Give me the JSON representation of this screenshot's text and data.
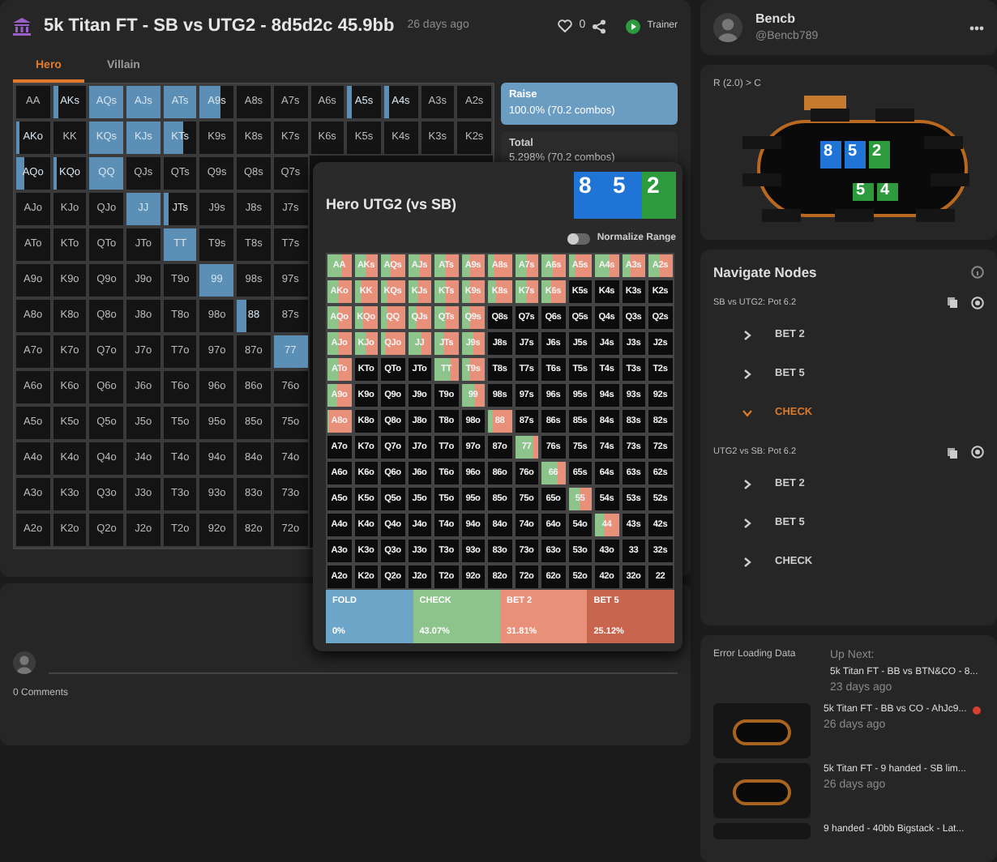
{
  "header": {
    "title": "5k Titan FT - SB vs UTG2 - 8d5d2c 45.9bb",
    "age": "26 days ago",
    "likes": "0",
    "trainer": "Trainer"
  },
  "tabs": [
    {
      "label": "Hero",
      "selected": true
    },
    {
      "label": "Villain",
      "selected": false
    }
  ],
  "range_grid": {
    "rows": [
      [
        {
          "hand": "AA"
        },
        {
          "hand": "AKs",
          "level": 0.15
        },
        {
          "hand": "AQs",
          "level": 1
        },
        {
          "hand": "AJs",
          "level": 1
        },
        {
          "hand": "ATs",
          "level": 1
        },
        {
          "hand": "A9s",
          "level": 0.6
        },
        {
          "hand": "A8s"
        },
        {
          "hand": "A7s"
        },
        {
          "hand": "A6s"
        },
        {
          "hand": "A5s",
          "level": 0.15
        },
        {
          "hand": "A4s",
          "level": 0.15
        },
        {
          "hand": "A3s"
        },
        {
          "hand": "A2s"
        }
      ],
      [
        {
          "hand": "AKo",
          "level": 0.1
        },
        {
          "hand": "KK"
        },
        {
          "hand": "KQs",
          "level": 1
        },
        {
          "hand": "KJs",
          "level": 1
        },
        {
          "hand": "KTs",
          "level": 0.6
        },
        {
          "hand": "K9s"
        },
        {
          "hand": "K8s"
        },
        {
          "hand": "K7s"
        },
        {
          "hand": "K6s"
        },
        {
          "hand": "K5s"
        },
        {
          "hand": "K4s"
        },
        {
          "hand": "K3s"
        },
        {
          "hand": "K2s"
        }
      ],
      [
        {
          "hand": "AQo",
          "level": 0.25
        },
        {
          "hand": "KQo",
          "level": 0.1
        },
        {
          "hand": "QQ",
          "level": 1
        },
        {
          "hand": "QJs"
        },
        {
          "hand": "QTs"
        },
        {
          "hand": "Q9s"
        },
        {
          "hand": "Q8s"
        },
        {
          "hand": "Q7s"
        }
      ],
      [
        {
          "hand": "AJo"
        },
        {
          "hand": "KJo"
        },
        {
          "hand": "QJo"
        },
        {
          "hand": "JJ",
          "level": 1
        },
        {
          "hand": "JTs",
          "level": 0.15
        },
        {
          "hand": "J9s"
        },
        {
          "hand": "J8s"
        },
        {
          "hand": "J7s"
        }
      ],
      [
        {
          "hand": "ATo"
        },
        {
          "hand": "KTo"
        },
        {
          "hand": "QTo"
        },
        {
          "hand": "JTo"
        },
        {
          "hand": "TT",
          "level": 1
        },
        {
          "hand": "T9s"
        },
        {
          "hand": "T8s"
        },
        {
          "hand": "T7s"
        }
      ],
      [
        {
          "hand": "A9o"
        },
        {
          "hand": "K9o"
        },
        {
          "hand": "Q9o"
        },
        {
          "hand": "J9o"
        },
        {
          "hand": "T9o"
        },
        {
          "hand": "99",
          "level": 1
        },
        {
          "hand": "98s"
        },
        {
          "hand": "97s"
        }
      ],
      [
        {
          "hand": "A8o"
        },
        {
          "hand": "K8o"
        },
        {
          "hand": "Q8o"
        },
        {
          "hand": "J8o"
        },
        {
          "hand": "T8o"
        },
        {
          "hand": "98o"
        },
        {
          "hand": "88",
          "level": 0.3
        },
        {
          "hand": "87s"
        }
      ],
      [
        {
          "hand": "A7o"
        },
        {
          "hand": "K7o"
        },
        {
          "hand": "Q7o"
        },
        {
          "hand": "J7o"
        },
        {
          "hand": "T7o"
        },
        {
          "hand": "97o"
        },
        {
          "hand": "87o"
        },
        {
          "hand": "77",
          "level": 1
        }
      ],
      [
        {
          "hand": "A6o"
        },
        {
          "hand": "K6o"
        },
        {
          "hand": "Q6o"
        },
        {
          "hand": "J6o"
        },
        {
          "hand": "T6o"
        },
        {
          "hand": "96o"
        },
        {
          "hand": "86o"
        },
        {
          "hand": "76o"
        }
      ],
      [
        {
          "hand": "A5o"
        },
        {
          "hand": "K5o"
        },
        {
          "hand": "Q5o"
        },
        {
          "hand": "J5o"
        },
        {
          "hand": "T5o"
        },
        {
          "hand": "95o"
        },
        {
          "hand": "85o"
        },
        {
          "hand": "75o"
        }
      ],
      [
        {
          "hand": "A4o"
        },
        {
          "hand": "K4o"
        },
        {
          "hand": "Q4o"
        },
        {
          "hand": "J4o"
        },
        {
          "hand": "T4o"
        },
        {
          "hand": "94o"
        },
        {
          "hand": "84o"
        },
        {
          "hand": "74o"
        }
      ],
      [
        {
          "hand": "A3o"
        },
        {
          "hand": "K3o"
        },
        {
          "hand": "Q3o"
        },
        {
          "hand": "J3o"
        },
        {
          "hand": "T3o"
        },
        {
          "hand": "93o"
        },
        {
          "hand": "83o"
        },
        {
          "hand": "73o"
        }
      ],
      [
        {
          "hand": "A2o"
        },
        {
          "hand": "K2o"
        },
        {
          "hand": "Q2o"
        },
        {
          "hand": "J2o"
        },
        {
          "hand": "T2o"
        },
        {
          "hand": "92o"
        },
        {
          "hand": "82o"
        },
        {
          "hand": "72o"
        }
      ]
    ]
  },
  "summary": [
    {
      "kind": "action",
      "label": "Raise",
      "value": "100.0% (70.2 combos)"
    },
    {
      "kind": "total",
      "label": "Total",
      "value": "5.298% (70.2 combos)"
    }
  ],
  "popup": {
    "title": "Hero UTG2 (vs SB)",
    "board": [
      {
        "rank": "8",
        "color": "#1f74d6"
      },
      {
        "rank": "5",
        "color": "#1f74d6"
      },
      {
        "rank": "2",
        "color": "#2e9a3e"
      }
    ],
    "normalize": {
      "label": "Normalize Range",
      "on": false
    },
    "rows": [
      [
        {
          "hand": "AA",
          "level": 0.6
        },
        {
          "hand": "AKs",
          "level": 0.5
        },
        {
          "hand": "AQs",
          "level": 0.4
        },
        {
          "hand": "AJs",
          "level": 0.55
        },
        {
          "hand": "ATs",
          "level": 0.5
        },
        {
          "hand": "A9s",
          "level": 0.4
        },
        {
          "hand": "A8s",
          "level": 0.3
        },
        {
          "hand": "A7s",
          "level": 0.5
        },
        {
          "hand": "A6s",
          "level": 0.45
        },
        {
          "hand": "A5s",
          "level": 0.3
        },
        {
          "hand": "A4s",
          "level": 0.6
        },
        {
          "hand": "A3s",
          "level": 0.4
        },
        {
          "hand": "A2s",
          "level": 0.5
        }
      ],
      [
        {
          "hand": "AKo",
          "level": 0.5
        },
        {
          "hand": "KK",
          "level": 0.3
        },
        {
          "hand": "KQs",
          "level": 0.3
        },
        {
          "hand": "KJs",
          "level": 0.45
        },
        {
          "hand": "KTs",
          "level": 0.5
        },
        {
          "hand": "K9s",
          "level": 0.4
        },
        {
          "hand": "K8s",
          "level": 0.35
        },
        {
          "hand": "K7s",
          "level": 0.5
        },
        {
          "hand": "K6s",
          "level": 0.4
        },
        {
          "hand": "K5s"
        },
        {
          "hand": "K4s"
        },
        {
          "hand": "K3s"
        },
        {
          "hand": "K2s"
        }
      ],
      [
        {
          "hand": "AQo",
          "level": 0.5
        },
        {
          "hand": "KQo",
          "level": 0.4
        },
        {
          "hand": "QQ",
          "level": 0.3
        },
        {
          "hand": "QJs",
          "level": 0.4
        },
        {
          "hand": "QTs",
          "level": 0.5
        },
        {
          "hand": "Q9s",
          "level": 0.4
        },
        {
          "hand": "Q8s"
        },
        {
          "hand": "Q7s"
        },
        {
          "hand": "Q6s"
        },
        {
          "hand": "Q5s"
        },
        {
          "hand": "Q4s"
        },
        {
          "hand": "Q3s"
        },
        {
          "hand": "Q2s"
        }
      ],
      [
        {
          "hand": "AJo",
          "level": 0.5
        },
        {
          "hand": "KJo",
          "level": 0.5
        },
        {
          "hand": "QJo",
          "level": 0.2
        },
        {
          "hand": "JJ",
          "level": 0.6
        },
        {
          "hand": "JTs",
          "level": 0.4
        },
        {
          "hand": "J9s",
          "level": 0.5
        },
        {
          "hand": "J8s"
        },
        {
          "hand": "J7s"
        },
        {
          "hand": "J6s"
        },
        {
          "hand": "J5s"
        },
        {
          "hand": "J4s"
        },
        {
          "hand": "J3s"
        },
        {
          "hand": "J2s"
        }
      ],
      [
        {
          "hand": "ATo",
          "level": 0.5
        },
        {
          "hand": "KTo"
        },
        {
          "hand": "QTo"
        },
        {
          "hand": "JTo"
        },
        {
          "hand": "TT",
          "level": 0.7
        },
        {
          "hand": "T9s",
          "level": 0.4
        },
        {
          "hand": "T8s"
        },
        {
          "hand": "T7s"
        },
        {
          "hand": "T6s"
        },
        {
          "hand": "T5s"
        },
        {
          "hand": "T4s"
        },
        {
          "hand": "T3s"
        },
        {
          "hand": "T2s"
        }
      ],
      [
        {
          "hand": "A9o",
          "level": 0.4
        },
        {
          "hand": "K9o"
        },
        {
          "hand": "Q9o"
        },
        {
          "hand": "J9o"
        },
        {
          "hand": "T9o"
        },
        {
          "hand": "99",
          "level": 0.6
        },
        {
          "hand": "98s"
        },
        {
          "hand": "97s"
        },
        {
          "hand": "96s"
        },
        {
          "hand": "95s"
        },
        {
          "hand": "94s"
        },
        {
          "hand": "93s"
        },
        {
          "hand": "92s"
        }
      ],
      [
        {
          "hand": "A8o",
          "level": 0.1
        },
        {
          "hand": "K8o"
        },
        {
          "hand": "Q8o"
        },
        {
          "hand": "J8o"
        },
        {
          "hand": "T8o"
        },
        {
          "hand": "98o"
        },
        {
          "hand": "88",
          "level": 0.2
        },
        {
          "hand": "87s"
        },
        {
          "hand": "86s"
        },
        {
          "hand": "85s"
        },
        {
          "hand": "84s"
        },
        {
          "hand": "83s"
        },
        {
          "hand": "82s"
        }
      ],
      [
        {
          "hand": "A7o"
        },
        {
          "hand": "K7o"
        },
        {
          "hand": "Q7o"
        },
        {
          "hand": "J7o"
        },
        {
          "hand": "T7o"
        },
        {
          "hand": "97o"
        },
        {
          "hand": "87o"
        },
        {
          "hand": "77",
          "level": 0.8
        },
        {
          "hand": "76s"
        },
        {
          "hand": "75s"
        },
        {
          "hand": "74s"
        },
        {
          "hand": "73s"
        },
        {
          "hand": "72s"
        }
      ],
      [
        {
          "hand": "A6o"
        },
        {
          "hand": "K6o"
        },
        {
          "hand": "Q6o"
        },
        {
          "hand": "J6o"
        },
        {
          "hand": "T6o"
        },
        {
          "hand": "96o"
        },
        {
          "hand": "86o"
        },
        {
          "hand": "76o"
        },
        {
          "hand": "66",
          "level": 0.7
        },
        {
          "hand": "65s"
        },
        {
          "hand": "64s"
        },
        {
          "hand": "63s"
        },
        {
          "hand": "62s"
        }
      ],
      [
        {
          "hand": "A5o"
        },
        {
          "hand": "K5o"
        },
        {
          "hand": "Q5o"
        },
        {
          "hand": "J5o"
        },
        {
          "hand": "T5o"
        },
        {
          "hand": "95o"
        },
        {
          "hand": "85o"
        },
        {
          "hand": "75o"
        },
        {
          "hand": "65o"
        },
        {
          "hand": "55",
          "level": 0.5
        },
        {
          "hand": "54s"
        },
        {
          "hand": "53s"
        },
        {
          "hand": "52s"
        }
      ],
      [
        {
          "hand": "A4o"
        },
        {
          "hand": "K4o"
        },
        {
          "hand": "Q4o"
        },
        {
          "hand": "J4o"
        },
        {
          "hand": "T4o"
        },
        {
          "hand": "94o"
        },
        {
          "hand": "84o"
        },
        {
          "hand": "74o"
        },
        {
          "hand": "64o"
        },
        {
          "hand": "54o"
        },
        {
          "hand": "44",
          "level": 0.4
        },
        {
          "hand": "43s"
        },
        {
          "hand": "42s"
        }
      ],
      [
        {
          "hand": "A3o"
        },
        {
          "hand": "K3o"
        },
        {
          "hand": "Q3o"
        },
        {
          "hand": "J3o"
        },
        {
          "hand": "T3o"
        },
        {
          "hand": "93o"
        },
        {
          "hand": "83o"
        },
        {
          "hand": "73o"
        },
        {
          "hand": "63o"
        },
        {
          "hand": "53o"
        },
        {
          "hand": "43o"
        },
        {
          "hand": "33"
        },
        {
          "hand": "32s"
        }
      ],
      [
        {
          "hand": "A2o"
        },
        {
          "hand": "K2o"
        },
        {
          "hand": "Q2o"
        },
        {
          "hand": "J2o"
        },
        {
          "hand": "T2o"
        },
        {
          "hand": "92o"
        },
        {
          "hand": "82o"
        },
        {
          "hand": "72o"
        },
        {
          "hand": "62o"
        },
        {
          "hand": "52o"
        },
        {
          "hand": "42o"
        },
        {
          "hand": "32o"
        },
        {
          "hand": "22"
        }
      ]
    ],
    "legend": [
      {
        "label": "FOLD",
        "value": "0%",
        "color": "#6ea6c9"
      },
      {
        "label": "CHECK",
        "value": "43.07%",
        "color": "#8cc48c"
      },
      {
        "label": "BET 2",
        "value": "31.81%",
        "color": "#e8907a"
      },
      {
        "label": "BET 5",
        "value": "25.12%",
        "color": "#c8654f"
      }
    ]
  },
  "comments": {
    "count": "0 Comments"
  },
  "profile": {
    "name": "Bencb",
    "handle": "@Bencb789"
  },
  "table": {
    "action": "R (2.0) > C",
    "board": [
      {
        "rank": "8",
        "color": "#1f74d6"
      },
      {
        "rank": "5",
        "color": "#1f74d6"
      },
      {
        "rank": "2",
        "color": "#2e9a3e"
      }
    ],
    "hero_cards": [
      {
        "rank": "5",
        "color": "#2e9a3e"
      },
      {
        "rank": "4",
        "color": "#2e9a3e"
      }
    ]
  },
  "nodes": {
    "title": "Navigate Nodes",
    "groups": [
      {
        "label": "SB vs UTG2: Pot 6.2",
        "items": [
          {
            "label": "BET 2",
            "expanded": false
          },
          {
            "label": "BET 5",
            "expanded": false
          },
          {
            "label": "CHECK",
            "expanded": true
          }
        ]
      },
      {
        "label": "UTG2 vs SB: Pot 6.2",
        "items": [
          {
            "label": "BET 2",
            "expanded": false
          },
          {
            "label": "BET 5",
            "expanded": false
          },
          {
            "label": "CHECK",
            "expanded": false
          }
        ]
      }
    ]
  },
  "up_next": {
    "error": "Error Loading Data",
    "label": "Up Next:",
    "title": "5k Titan FT - BB vs BTN&CO - 8...",
    "age": "23 days ago",
    "videos": [
      {
        "title": "5k Titan FT - BB vs CO - AhJc9...",
        "age": "26 days ago",
        "unread": true
      },
      {
        "title": "5k Titan FT - 9 handed - SB lim...",
        "age": "26 days ago",
        "unread": false
      },
      {
        "title": "9 handed - 40bb Bigstack - Lat...",
        "unread": false
      }
    ]
  }
}
